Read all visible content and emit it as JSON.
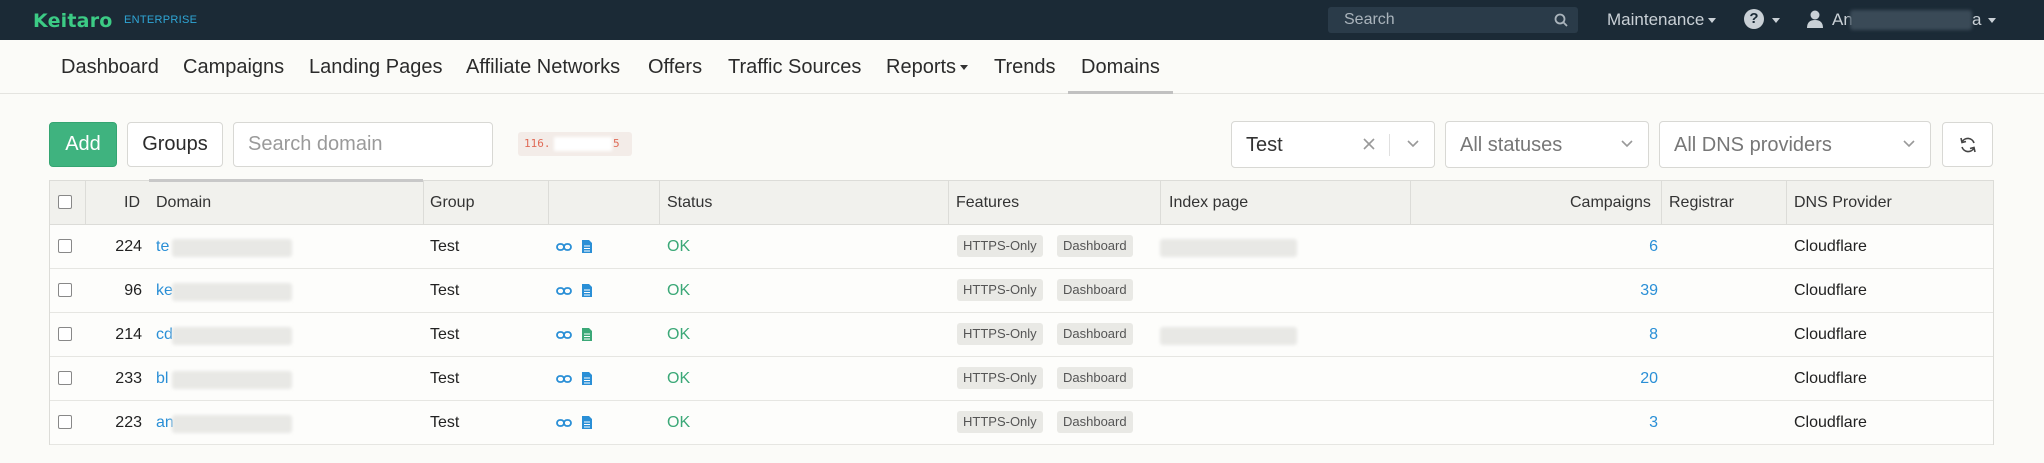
{
  "app": {
    "brand": "Keitaro",
    "edition": "ENTERPRISE",
    "search_placeholder": "Search",
    "maintenance_label": "Maintenance",
    "help_label": "?",
    "user_name_prefix": "An",
    "user_name_suffix": "a"
  },
  "nav": {
    "items": [
      {
        "label": "Dashboard"
      },
      {
        "label": "Campaigns"
      },
      {
        "label": "Landing Pages"
      },
      {
        "label": "Affiliate Networks"
      },
      {
        "label": "Offers"
      },
      {
        "label": "Traffic Sources"
      },
      {
        "label": "Reports"
      },
      {
        "label": "Trends"
      },
      {
        "label": "Domains"
      }
    ],
    "active": "Domains"
  },
  "toolbar": {
    "add_label": "Add",
    "groups_label": "Groups",
    "search_placeholder": "Search domain",
    "ip_prefix": "116.",
    "ip_suffix": "5",
    "group_filter_value": "Test",
    "status_filter_placeholder": "All statuses",
    "dns_filter_placeholder": "All DNS providers"
  },
  "table": {
    "columns": {
      "id": "ID",
      "domain": "Domain",
      "group": "Group",
      "status": "Status",
      "features": "Features",
      "index_page": "Index page",
      "campaigns": "Campaigns",
      "registrar": "Registrar",
      "dns_provider": "DNS Provider"
    },
    "rows": [
      {
        "id": "224",
        "domain": "te",
        "group": "Test",
        "status": "OK",
        "features": [
          "HTTPS-Only",
          "Dashboard"
        ],
        "has_index": true,
        "campaigns": "6",
        "registrar": "",
        "dns_provider": "Cloudflare",
        "page_icon_color": "#2a8fd6"
      },
      {
        "id": "96",
        "domain": "ke",
        "group": "Test",
        "status": "OK",
        "features": [
          "HTTPS-Only",
          "Dashboard"
        ],
        "has_index": false,
        "campaigns": "39",
        "registrar": "",
        "dns_provider": "Cloudflare",
        "page_icon_color": "#2a8fd6"
      },
      {
        "id": "214",
        "domain": "cd",
        "group": "Test",
        "status": "OK",
        "features": [
          "HTTPS-Only",
          "Dashboard"
        ],
        "has_index": true,
        "campaigns": "8",
        "registrar": "",
        "dns_provider": "Cloudflare",
        "page_icon_color": "#3ba877"
      },
      {
        "id": "233",
        "domain": "bl",
        "group": "Test",
        "status": "OK",
        "features": [
          "HTTPS-Only",
          "Dashboard"
        ],
        "has_index": false,
        "campaigns": "20",
        "registrar": "",
        "dns_provider": "Cloudflare",
        "page_icon_color": "#2a8fd6"
      },
      {
        "id": "223",
        "domain": "an",
        "group": "Test",
        "status": "OK",
        "features": [
          "HTTPS-Only",
          "Dashboard"
        ],
        "has_index": false,
        "campaigns": "3",
        "registrar": "",
        "dns_provider": "Cloudflare",
        "page_icon_color": "#2a8fd6"
      }
    ]
  },
  "colors": {
    "topbar": "#1b2a36",
    "brand": "#3ccb85",
    "accent_green": "#3fb37f",
    "link_blue": "#2a8fd6",
    "ok_green": "#3ba877"
  }
}
